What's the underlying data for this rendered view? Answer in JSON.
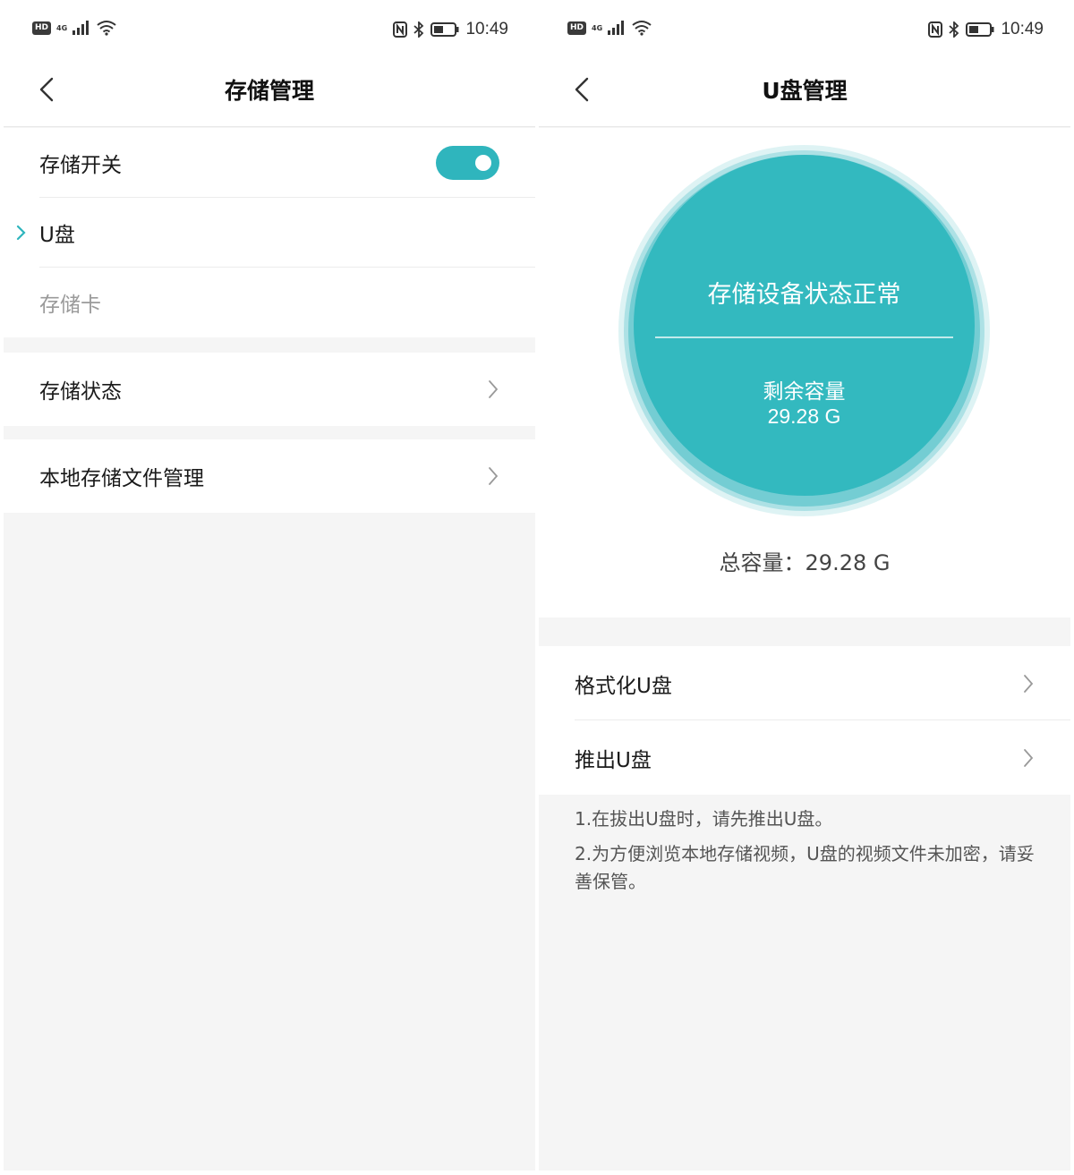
{
  "status_bar": {
    "hd": "HD",
    "network": "4G",
    "time": "10:49"
  },
  "left": {
    "title": "存储管理",
    "storage_switch_label": "存储开关",
    "storage_switch_on": true,
    "options": [
      {
        "label": "U盘",
        "selected": true
      },
      {
        "label": "存储卡",
        "selected": false
      }
    ],
    "storage_status_label": "存储状态",
    "local_files_label": "本地存储文件管理"
  },
  "right": {
    "title": "U盘管理",
    "device_status": "存储设备状态正常",
    "remaining_label": "剩余容量",
    "remaining_value": "29.28 G",
    "total_text": "总容量：29.28 G",
    "format_label": "格式化U盘",
    "eject_label": "推出U盘",
    "notes": [
      "1.在拔出U盘时，请先推出U盘。",
      "2.为方便浏览本地存储视频，U盘的视频文件未加密，请妥善保管。"
    ]
  },
  "colors": {
    "accent": "#2fb5bd",
    "circle": "#33b9bf",
    "background": "#f5f5f5"
  },
  "icons": [
    "back-arrow-icon",
    "chevron-right-icon",
    "nfc-icon",
    "bluetooth-icon",
    "battery-icon",
    "wifi-icon",
    "signal-icon"
  ]
}
